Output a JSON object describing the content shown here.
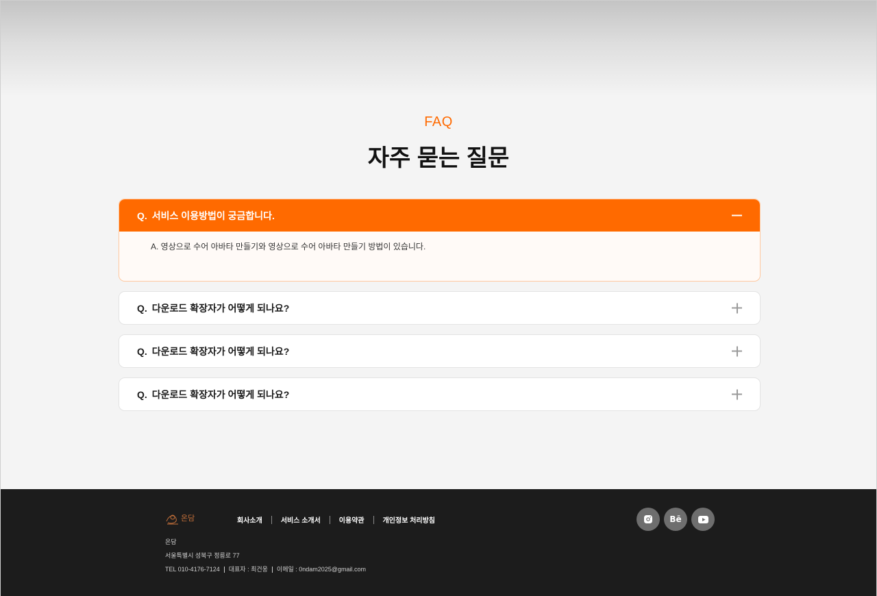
{
  "faq": {
    "eyebrow": "FAQ",
    "title": "자주 묻는 질문",
    "items": [
      {
        "prefix": "Q.",
        "question": "서비스 이용방법이 궁금합니다.",
        "answer": "A. 영상으로 수어 아바타 만들기와 영상으로 수어 아바타 만들기 방법이 있습니다.",
        "open": true
      },
      {
        "prefix": "Q.",
        "question": "다운로드 확장자가 어떻게 되나요?",
        "open": false
      },
      {
        "prefix": "Q.",
        "question": "다운로드 확장자가 어떻게 되나요?",
        "open": false
      },
      {
        "prefix": "Q.",
        "question": "다운로드 확장자가 어떻게 되나요?",
        "open": false
      }
    ]
  },
  "footer": {
    "logo_text": "온담",
    "nav": [
      "회사소개",
      "서비스 소개서",
      "이용약관",
      "개인정보 처리방침"
    ],
    "company": "온담",
    "address": "서울특별시 성북구 정릉로 77",
    "tel": "TEL 010-4176-7124",
    "ceo": "대표자 : 최건웅",
    "email": "이메일 : 0ndam2025@gmail.com",
    "social": [
      {
        "icon": "instagram-icon"
      },
      {
        "icon": "behance-icon",
        "label": "Bē"
      },
      {
        "icon": "youtube-icon"
      }
    ]
  },
  "colors": {
    "accent": "#ff6a00",
    "footer_bg": "#1c1c1c",
    "page_bg": "#f4f4f4"
  }
}
